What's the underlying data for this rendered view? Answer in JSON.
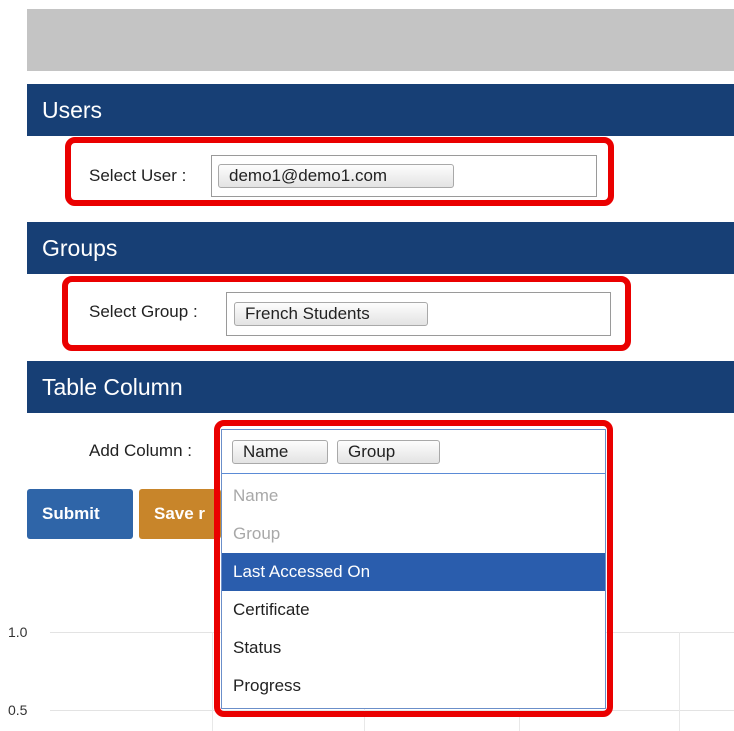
{
  "users": {
    "header": "Users",
    "label": "Select User :",
    "selected": "demo1@demo1.com"
  },
  "groups": {
    "header": "Groups",
    "label": "Select Group :",
    "selected": "French Students"
  },
  "table_column": {
    "header": "Table Column",
    "label": "Add Column :",
    "selected_chips": [
      "Name",
      "Group"
    ],
    "options": [
      {
        "label": "Name",
        "state": "disabled"
      },
      {
        "label": "Group",
        "state": "disabled"
      },
      {
        "label": "Last Accessed On",
        "state": "highlighted"
      },
      {
        "label": "Certificate",
        "state": "normal"
      },
      {
        "label": "Status",
        "state": "normal"
      },
      {
        "label": "Progress",
        "state": "normal"
      }
    ]
  },
  "buttons": {
    "submit": "Submit",
    "save": "Save r"
  },
  "chart": {
    "ticks": [
      "1.0",
      "0.5"
    ]
  },
  "colors": {
    "header_bg": "#173f75",
    "annotation_red": "#ea0000",
    "submit_bg": "#2f65a8",
    "save_bg": "#c8852a",
    "highlight_bg": "#2a5dad"
  }
}
